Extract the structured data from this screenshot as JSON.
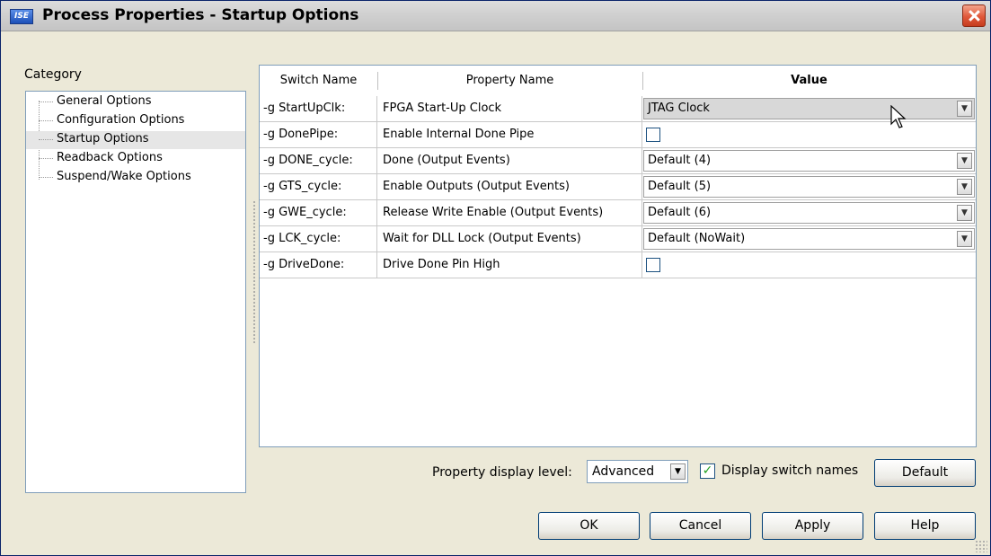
{
  "window": {
    "title": "Process Properties - Startup Options",
    "app_icon_text": "ISE"
  },
  "category": {
    "label": "Category",
    "items": [
      {
        "label": "General Options"
      },
      {
        "label": "Configuration Options"
      },
      {
        "label": "Startup Options",
        "selected": true
      },
      {
        "label": "Readback Options"
      },
      {
        "label": "Suspend/Wake Options"
      }
    ]
  },
  "table": {
    "headers": {
      "switch": "Switch Name",
      "property": "Property Name",
      "value": "Value"
    },
    "rows": [
      {
        "switch": "-g StartUpClk:",
        "property": "FPGA Start-Up Clock",
        "type": "dropdown",
        "value": "JTAG Clock"
      },
      {
        "switch": "-g DonePipe:",
        "property": "Enable Internal Done Pipe",
        "type": "checkbox",
        "checked": false
      },
      {
        "switch": "-g DONE_cycle:",
        "property": "Done (Output Events)",
        "type": "dropdown",
        "value": "Default (4)"
      },
      {
        "switch": "-g GTS_cycle:",
        "property": "Enable Outputs (Output Events)",
        "type": "dropdown",
        "value": "Default (5)"
      },
      {
        "switch": "-g GWE_cycle:",
        "property": "Release Write Enable (Output Events)",
        "type": "dropdown",
        "value": "Default (6)"
      },
      {
        "switch": "-g LCK_cycle:",
        "property": "Wait for DLL Lock (Output Events)",
        "type": "dropdown",
        "value": "Default (NoWait)"
      },
      {
        "switch": "-g DriveDone:",
        "property": "Drive Done Pin High",
        "type": "checkbox",
        "checked": false
      }
    ]
  },
  "footer": {
    "display_level_label": "Property display level:",
    "display_level_value": "Advanced",
    "display_switch_names_label": "Display switch names",
    "display_switch_names_checked": true,
    "default_label": "Default"
  },
  "buttons": {
    "ok": "OK",
    "cancel": "Cancel",
    "apply": "Apply",
    "help": "Help"
  }
}
